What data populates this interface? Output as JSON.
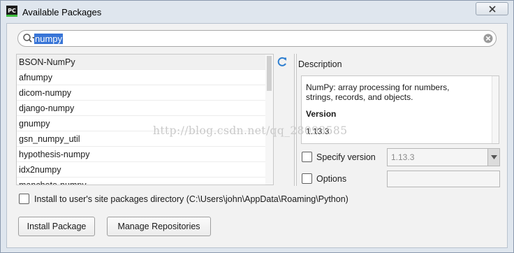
{
  "window": {
    "title": "Available Packages",
    "app_icon_text": "PC",
    "close_icon": "close-icon"
  },
  "search": {
    "value": "numpy",
    "icon": "search-icon",
    "clear_icon": "clear-icon"
  },
  "packages": {
    "items": [
      "BSON-NumPy",
      "afnumpy",
      "dicom-numpy",
      "django-numpy",
      "gnumpy",
      "gsn_numpy_util",
      "hypothesis-numpy",
      "idx2numpy",
      "manchete-numpy"
    ],
    "selected_index": 0
  },
  "refresh_icon": "refresh-icon",
  "description": {
    "label": "Description",
    "text_line1": "NumPy: array processing for numbers,",
    "text_line2": "strings, records, and objects.",
    "version_heading": "Version",
    "version_value": "1.13.3"
  },
  "options": {
    "specify_version_label": "Specify version",
    "specify_version_value": "1.13.3",
    "options_label": "Options",
    "options_value": ""
  },
  "install_to_user": {
    "label": "Install to user's site packages directory (C:\\Users\\john\\AppData\\Roaming\\Python)",
    "checked": false
  },
  "buttons": {
    "install": "Install Package",
    "manage": "Manage Repositories"
  },
  "watermark": "http://blog.csdn.net/qq_28093585",
  "colors": {
    "selection": "#3875d7",
    "refresh_icon": "#2f7fd0",
    "window_frame": "#dfe6ee"
  }
}
